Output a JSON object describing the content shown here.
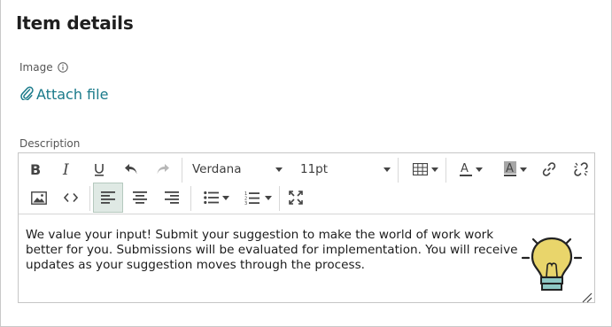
{
  "page": {
    "title": "Item details"
  },
  "image_section": {
    "label": "Image",
    "info_icon": "info-circle-icon"
  },
  "attach": {
    "label": "Attach file",
    "icon": "paperclip-icon",
    "color": "#1a7a8a"
  },
  "description": {
    "label": "Description",
    "toolbar": {
      "font_family": "Verdana",
      "font_size": "11pt",
      "buttons_row1": [
        "bold",
        "italic",
        "underline",
        "undo",
        "redo",
        "font-family",
        "font-size",
        "table",
        "text-color",
        "highlight-color",
        "link",
        "unlink"
      ],
      "buttons_row2": [
        "insert-image",
        "source-code",
        "align-left",
        "align-center",
        "align-right",
        "bullet-list",
        "numbered-list",
        "fullscreen"
      ],
      "active": "align-left",
      "active_color": "#dfe9e4"
    },
    "content": "We value your input! Submit your suggestion to make the world of work work better for you. Submissions will be evaluated for implementation. You will receive updates as your suggestion moves through the process.",
    "image_icon": "lightbulb-icon",
    "bulb_color": "#e9d56b",
    "bulb_base_color": "#8ec8c4"
  }
}
